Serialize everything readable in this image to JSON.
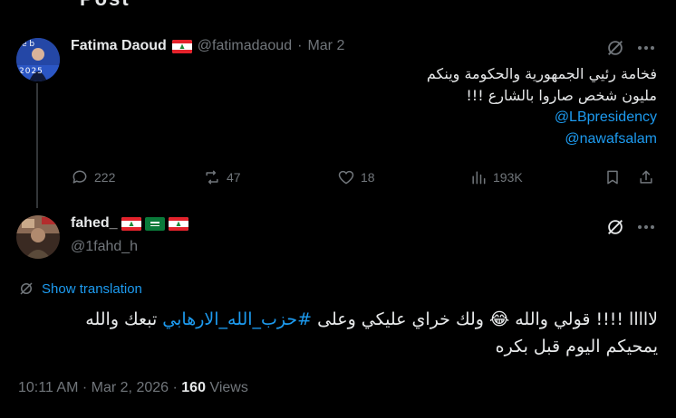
{
  "cut_off_text": "Post",
  "first_tweet": {
    "display_name": "Fatima Daoud",
    "handle": "@fatimadaoud",
    "separator": "·",
    "date": "Mar 2",
    "avatar_text": "2025",
    "text_line1": "فخامة رئيي الجمهورية والحكومة وينكم",
    "text_line2": "مليون شخص صاروا بالشارع !!!",
    "mention1": "@LBpresidency",
    "mention2": "@nawafsalam",
    "replies": "222",
    "reposts": "47",
    "likes": "18",
    "views": "193K"
  },
  "reply_tweet": {
    "display_name": "fahed_",
    "handle": "@1fahd_h",
    "show_translation": "Show translation",
    "text_line1_a": "لااااا !!!! قولي والله 😂 ولك خراي عليكي وعلى ",
    "hashtag": "#حزب_الله_الارهابي",
    "text_line1_b": " تبعك والله",
    "text_line2": "يمحيكم اليوم قبل بكره",
    "time": "10:11 AM",
    "dot": "·",
    "date": "Mar 2, 2026",
    "views_count": "160",
    "views_label": "Views"
  },
  "icons": {
    "reply": "reply-icon",
    "repost": "repost-icon",
    "like": "heart-icon",
    "views": "views-chart-icon",
    "bookmark": "bookmark-icon",
    "share": "share-icon",
    "grok": "grok-icon",
    "more": "more-icon",
    "translate": "translate-icon"
  },
  "colors": {
    "background": "#000000",
    "text": "#e7e9ea",
    "muted": "#71767b",
    "link": "#1d9bf0"
  }
}
